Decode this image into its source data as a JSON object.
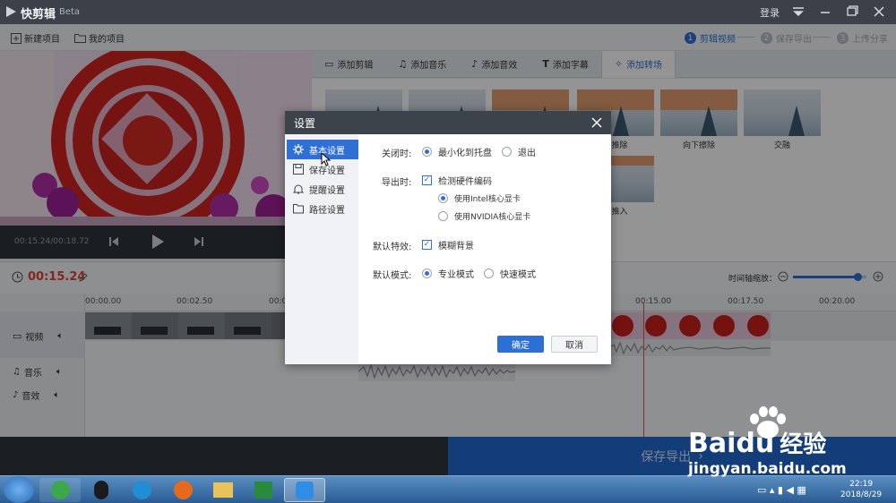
{
  "app": {
    "title": "快剪辑",
    "beta": "Beta",
    "login": "登录"
  },
  "toolbar": {
    "new_project": "新建项目",
    "my_projects": "我的项目",
    "steps": [
      {
        "num": "1",
        "label": "剪辑视频",
        "active": true
      },
      {
        "num": "2",
        "label": "保存导出",
        "active": false
      },
      {
        "num": "3",
        "label": "上传分享",
        "active": false
      }
    ]
  },
  "preview": {
    "time": "00:15.24/00:18.72"
  },
  "tabs": [
    {
      "label": "添加剪辑",
      "icon": "video-camera-icon"
    },
    {
      "label": "添加音乐",
      "icon": "music-note-icon"
    },
    {
      "label": "添加音效",
      "icon": "sound-effect-icon"
    },
    {
      "label": "添加字幕",
      "icon": "text-t-icon"
    },
    {
      "label": "添加转场",
      "icon": "transition-star-icon",
      "active": true
    }
  ],
  "transitions": {
    "labels": [
      "上推除",
      "向下擦除",
      "交融",
      "下推入"
    ]
  },
  "timeline": {
    "current_time": "00:15.24",
    "zoom_label": "时间轴缩放：",
    "zoom_level": 0.88,
    "ticks": [
      "00:00.00",
      "00:02.50",
      "00:0",
      "00:15.00",
      "00:17.50",
      "00:20.00"
    ],
    "tracks": {
      "video": "视频",
      "music": "音乐",
      "effects": "音效"
    }
  },
  "export_button": "保存导出",
  "dialog": {
    "title": "设置",
    "nav": [
      {
        "label": "基本设置",
        "icon": "gear-icon",
        "active": true
      },
      {
        "label": "保存设置",
        "icon": "save-icon",
        "active": false
      },
      {
        "label": "提醒设置",
        "icon": "bell-icon",
        "active": false
      },
      {
        "label": "路径设置",
        "icon": "folder-icon",
        "active": false
      }
    ],
    "close_label": "关闭时:",
    "close_options": [
      "最小化到托盘",
      "退出"
    ],
    "close_selected": 0,
    "export_label": "导出时:",
    "hw_encode": {
      "label": "检测硬件编码",
      "checked": true
    },
    "gpu_options": [
      "使用Intel核心显卡",
      "使用NVIDIA核心显卡"
    ],
    "gpu_selected": 0,
    "effects_label": "默认特效:",
    "blur": {
      "label": "模糊背景",
      "checked": true
    },
    "mode_label": "默认模式:",
    "mode_options": [
      "专业模式",
      "快速模式"
    ],
    "mode_selected": 0,
    "ok": "确定",
    "cancel": "取消"
  },
  "taskbar": {
    "time": "22:19",
    "date": "2018/8/29"
  },
  "watermark": {
    "brand": "Baidu",
    "brand_cn": "经验",
    "url": "jingyan.baidu.com"
  },
  "colors": {
    "accent": "#2f6fd6",
    "time_red": "#e2423b",
    "title_bar": "#3c4149"
  }
}
